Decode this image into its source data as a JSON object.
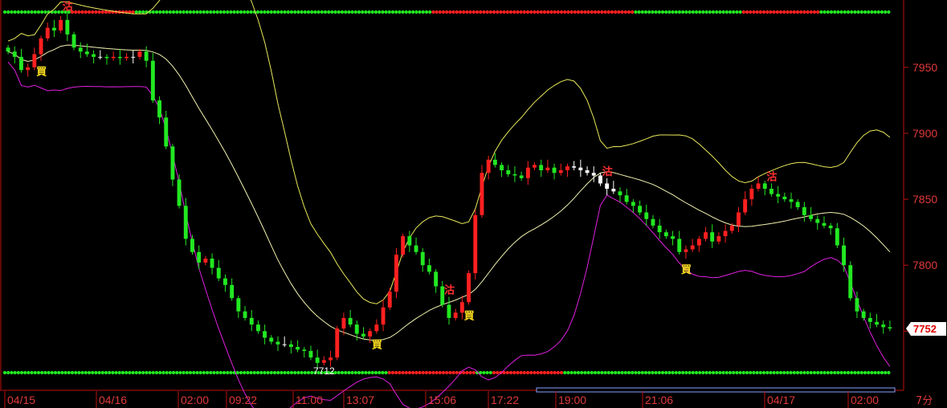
{
  "chart_data": {
    "type": "candlestick",
    "timeframe_label": "7分",
    "y_ticks": [
      7950,
      7900,
      7850,
      7800,
      7750
    ],
    "ylim": [
      7710,
      7995
    ],
    "x_ticks": [
      "04/15",
      "04/16",
      "02:00",
      "09:22",
      "11:00",
      "13:07",
      "15:06",
      "17:22",
      "19:00",
      "21:06",
      "04/17",
      "02:00"
    ],
    "last_price": "7752",
    "low_label": "7712",
    "colors": {
      "up": "#ff2020",
      "down": "#22e822",
      "neutral": "#ffffff",
      "ma_mid": "#f2f2b0",
      "band_upper": "#e8e85a",
      "band_lower": "#e020e0",
      "axis": "#c01010",
      "tick_text": "#e03a3a",
      "signal_red": "#ff2020",
      "signal_green": "#22e822",
      "buy_text": "#ffe020",
      "sell_text": "#ff3030"
    },
    "signals": [
      {
        "i": 5,
        "text": "買",
        "kind": "buy"
      },
      {
        "i": 9,
        "text": "沽",
        "kind": "sell"
      },
      {
        "i": 56,
        "text": "買",
        "kind": "buy"
      },
      {
        "i": 67,
        "text": "沽",
        "kind": "sell"
      },
      {
        "i": 70,
        "text": "買",
        "kind": "buy"
      },
      {
        "i": 91,
        "text": "沽",
        "kind": "sell"
      },
      {
        "i": 103,
        "text": "買",
        "kind": "buy"
      },
      {
        "i": 116,
        "text": "沽",
        "kind": "sell"
      }
    ],
    "upper_strip": [
      {
        "from": 0.0,
        "to": 0.075,
        "color": "green"
      },
      {
        "from": 0.075,
        "to": 0.145,
        "color": "red"
      },
      {
        "from": 0.145,
        "to": 0.48,
        "color": "green"
      },
      {
        "from": 0.48,
        "to": 0.71,
        "color": "red"
      },
      {
        "from": 0.71,
        "to": 0.83,
        "color": "green"
      },
      {
        "from": 0.83,
        "to": 0.92,
        "color": "red"
      },
      {
        "from": 0.92,
        "to": 1.0,
        "color": "green"
      }
    ],
    "lower_strip": [
      {
        "from": 0.0,
        "to": 0.43,
        "color": "green"
      },
      {
        "from": 0.43,
        "to": 0.53,
        "color": "red"
      },
      {
        "from": 0.53,
        "to": 0.55,
        "color": "green"
      },
      {
        "from": 0.55,
        "to": 0.63,
        "color": "red"
      },
      {
        "from": 0.63,
        "to": 0.9,
        "color": "green"
      },
      {
        "from": 0.9,
        "to": 1.0,
        "color": "green"
      }
    ],
    "series": [
      {
        "name": "close",
        "values": [
          7962,
          7958,
          7948,
          7950,
          7960,
          7972,
          7980,
          7978,
          7986,
          7975,
          7965,
          7962,
          7960,
          7958,
          7958,
          7957,
          7958,
          7957,
          7958,
          7958,
          7962,
          7955,
          7925,
          7912,
          7890,
          7865,
          7845,
          7820,
          7810,
          7802,
          7805,
          7798,
          7790,
          7785,
          7775,
          7765,
          7760,
          7755,
          7750,
          7745,
          7742,
          7740,
          7740,
          7738,
          7736,
          7735,
          7730,
          7726,
          7728,
          7730,
          7752,
          7760,
          7755,
          7748,
          7746,
          7750,
          7755,
          7768,
          7780,
          7808,
          7822,
          7815,
          7810,
          7800,
          7795,
          7784,
          7770,
          7760,
          7764,
          7772,
          7794,
          7838,
          7870,
          7880,
          7876,
          7872,
          7869,
          7868,
          7866,
          7874,
          7876,
          7872,
          7874,
          7870,
          7872,
          7875,
          7874,
          7872,
          7870,
          7868,
          7862,
          7858,
          7856,
          7853,
          7848,
          7845,
          7840,
          7835,
          7830,
          7825,
          7822,
          7820,
          7810,
          7812,
          7815,
          7820,
          7825,
          7818,
          7822,
          7826,
          7830,
          7840,
          7850,
          7858,
          7862,
          7858,
          7854,
          7852,
          7850,
          7848,
          7844,
          7838,
          7835,
          7832,
          7830,
          7828,
          7815,
          7800,
          7775,
          7765,
          7760,
          7757,
          7755,
          7753,
          7752
        ]
      }
    ]
  }
}
